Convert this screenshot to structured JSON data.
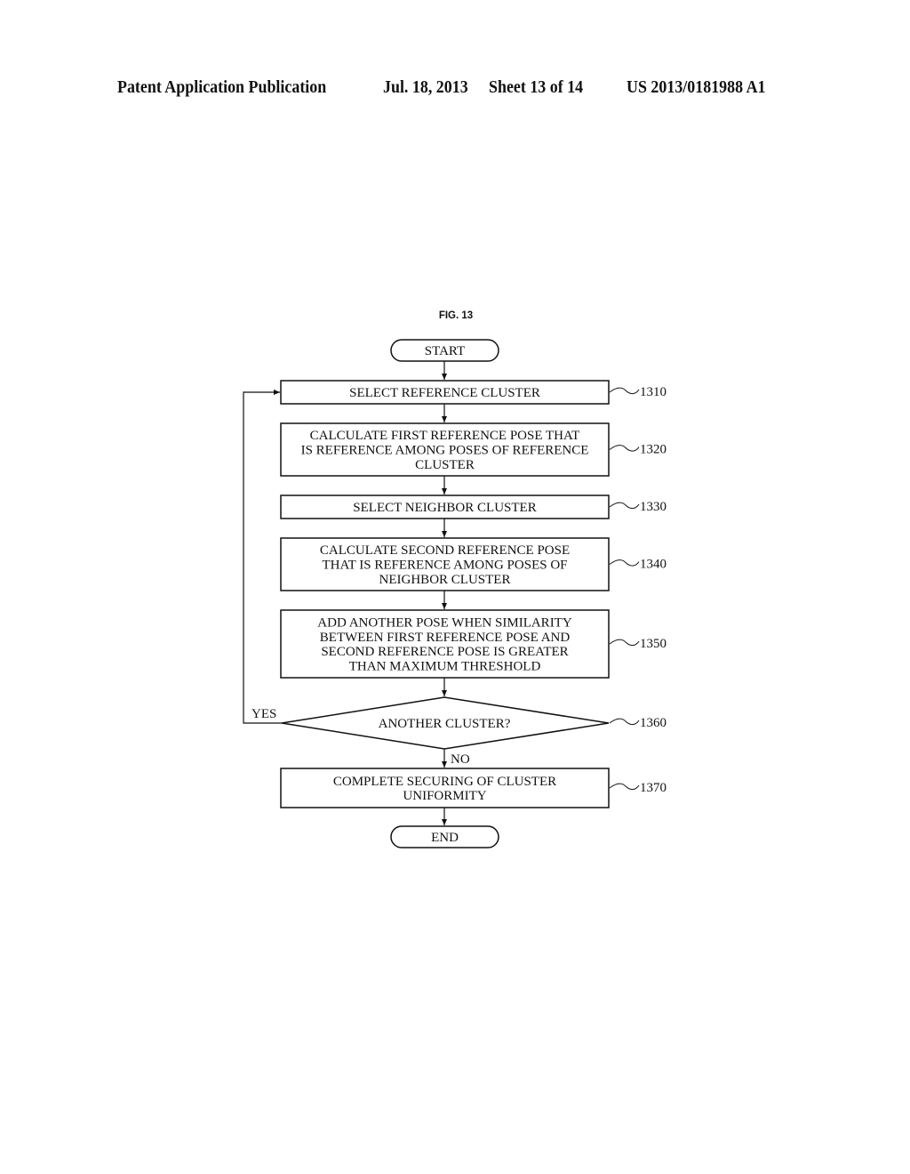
{
  "header": {
    "publication": "Patent Application Publication",
    "date": "Jul. 18, 2013",
    "sheet": "Sheet 13 of 14",
    "number": "US 2013/0181988 A1"
  },
  "figure": {
    "title": "FIG. 13",
    "start_label": "START",
    "end_label": "END",
    "steps": [
      {
        "ref": "1310",
        "lines": [
          "SELECT REFERENCE CLUSTER"
        ]
      },
      {
        "ref": "1320",
        "lines": [
          "CALCULATE FIRST REFERENCE POSE THAT",
          "IS REFERENCE AMONG POSES OF REFERENCE",
          "CLUSTER"
        ]
      },
      {
        "ref": "1330",
        "lines": [
          "SELECT NEIGHBOR CLUSTER"
        ]
      },
      {
        "ref": "1340",
        "lines": [
          "CALCULATE SECOND REFERENCE POSE",
          "THAT IS REFERENCE AMONG POSES OF",
          "NEIGHBOR CLUSTER"
        ]
      },
      {
        "ref": "1350",
        "lines": [
          "ADD ANOTHER POSE WHEN SIMILARITY",
          "BETWEEN FIRST REFERENCE POSE AND",
          "SECOND REFERENCE POSE IS GREATER",
          "THAN MAXIMUM THRESHOLD"
        ]
      }
    ],
    "decision": {
      "ref": "1360",
      "label": "ANOTHER CLUSTER?",
      "yes_label": "YES",
      "no_label": "NO"
    },
    "final_step": {
      "ref": "1370",
      "lines": [
        "COMPLETE SECURING OF CLUSTER",
        "UNIFORMITY"
      ]
    }
  }
}
